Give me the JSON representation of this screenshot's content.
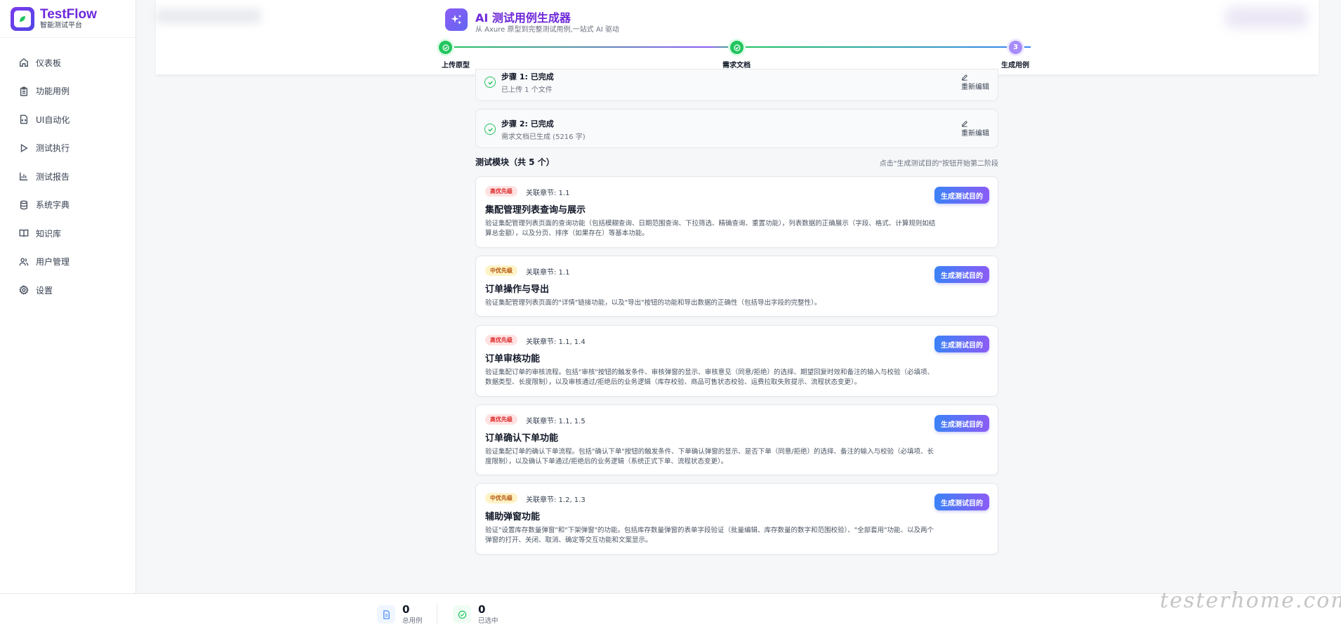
{
  "brand": {
    "name": "TestFlow",
    "subtitle": "智能测试平台"
  },
  "sidebar": {
    "items": [
      {
        "label": "仪表板",
        "icon": "home-icon"
      },
      {
        "label": "功能用例",
        "icon": "clipboard-icon"
      },
      {
        "label": "UI自动化",
        "icon": "code-file-icon"
      },
      {
        "label": "测试执行",
        "icon": "play-icon"
      },
      {
        "label": "测试报告",
        "icon": "bar-chart-icon"
      },
      {
        "label": "系统字典",
        "icon": "database-icon"
      },
      {
        "label": "知识库",
        "icon": "book-icon"
      },
      {
        "label": "用户管理",
        "icon": "users-icon"
      },
      {
        "label": "设置",
        "icon": "gear-icon"
      }
    ]
  },
  "generator": {
    "title": "AI 测试用例生成器",
    "subtitle": "从 Axure 原型到完整测试用例,一站式 AI 驱动",
    "steps": [
      {
        "label": "上传原型",
        "status": "done"
      },
      {
        "label": "需求文档",
        "status": "done"
      },
      {
        "label": "生成用例",
        "status": "current",
        "number": "3"
      }
    ]
  },
  "completed": [
    {
      "title": "步骤 1: 已完成",
      "subtitle": "已上传 1 个文件",
      "edit_label": "重新编辑"
    },
    {
      "title": "步骤 2: 已完成",
      "subtitle": "需求文档已生成 (5216 字)",
      "edit_label": "重新编辑"
    }
  ],
  "modules_section": {
    "title": "测试模块（共 5 个）",
    "hint": "点击\"生成测试目的\"按钮开始第二阶段",
    "button_label": "生成测试目的",
    "modules": [
      {
        "priority": "高优先级",
        "level": "high",
        "chapter": "关联章节: 1.1",
        "title": "集配管理列表查询与展示",
        "desc": "验证集配管理列表页面的查询功能（包括模糊查询、日期范围查询、下拉筛选、精确查询、重置功能），列表数据的正确展示（字段、格式、计算规则如结算总金额），以及分页、排序（如果存在）等基本功能。"
      },
      {
        "priority": "中优先级",
        "level": "mid",
        "chapter": "关联章节: 1.1",
        "title": "订单操作与导出",
        "desc": "验证集配管理列表页面的\"详情\"链接功能，以及\"导出\"按钮的功能和导出数据的正确性（包括导出字段的完整性）。"
      },
      {
        "priority": "高优先级",
        "level": "high",
        "chapter": "关联章节: 1.1, 1.4",
        "title": "订单审核功能",
        "desc": "验证集配订单的审核流程。包括\"审核\"按钮的触发条件、审核弹窗的显示、审核意见（同意/拒绝）的选择、期望回复时效和备注的输入与校验（必填项、数据类型、长度限制），以及审核通过/拒绝后的业务逻辑（库存校验、商品可售状态校验、运费拉取失败提示、流程状态变更）。"
      },
      {
        "priority": "高优先级",
        "level": "high",
        "chapter": "关联章节: 1.1, 1.5",
        "title": "订单确认下单功能",
        "desc": "验证集配订单的确认下单流程。包括\"确认下单\"按钮的触发条件、下单确认弹窗的显示、是否下单（同意/拒绝）的选择、备注的输入与校验（必填项、长度限制），以及确认下单通过/拒绝后的业务逻辑（系统正式下单、流程状态变更）。"
      },
      {
        "priority": "中优先级",
        "level": "mid",
        "chapter": "关联章节: 1.2, 1.3",
        "title": "辅助弹窗功能",
        "desc": "验证\"设置库存数量弹窗\"和\"下架弹窗\"的功能。包括库存数量弹窗的表单字段验证（批量编辑、库存数量的数字和范围校验）、\"全部套用\"功能、以及两个弹窗的打开、关闭、取消、确定等交互功能和文案显示。"
      }
    ]
  },
  "footer": {
    "total": {
      "value": "0",
      "label": "总用例"
    },
    "selected": {
      "value": "0",
      "label": "已选中"
    }
  },
  "watermark": "testerhome.com",
  "colors": {
    "accent": "#6d28d9",
    "success": "#22c55e",
    "danger": "#dc2626",
    "warning": "#b45309"
  }
}
